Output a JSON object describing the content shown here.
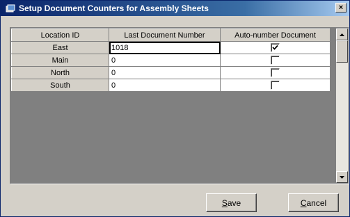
{
  "window": {
    "title": "Setup Document Counters for Assembly Sheets",
    "close_label": "×"
  },
  "grid": {
    "columns": [
      "Location ID",
      "Last Document Number",
      "Auto-number Document"
    ],
    "rows": [
      {
        "location": "East",
        "last_number": "1018",
        "auto_number": true
      },
      {
        "location": "Main",
        "last_number": "0",
        "auto_number": false
      },
      {
        "location": "North",
        "last_number": "0",
        "auto_number": false
      },
      {
        "location": "South",
        "last_number": "0",
        "auto_number": false
      }
    ]
  },
  "buttons": {
    "save_mnemonic": "S",
    "save_rest": "ave",
    "cancel_mnemonic": "C",
    "cancel_rest": "ancel"
  },
  "icons": {
    "title": "window-icon",
    "scroll_up": "arrow-up-icon",
    "scroll_down": "arrow-down-icon",
    "check": "checkmark-icon"
  },
  "colors": {
    "titlebar_start": "#0a246a",
    "titlebar_end": "#a6caf0",
    "face": "#d4d0c8"
  }
}
